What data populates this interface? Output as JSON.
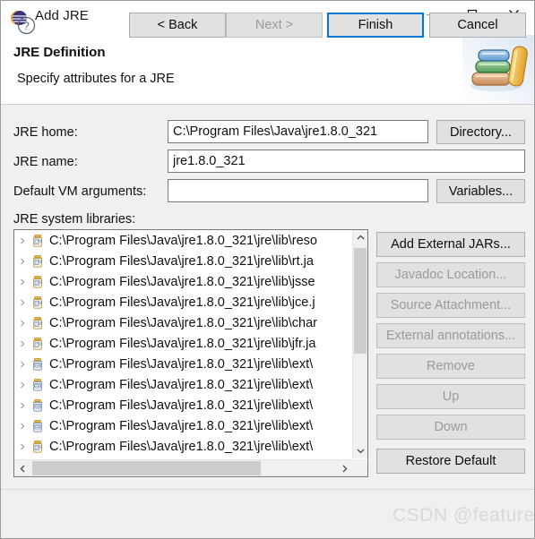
{
  "window": {
    "title": "Add JRE",
    "icon": "eclipse-icon",
    "controls": {
      "minimize": "minimize-icon",
      "maximize": "maximize-icon",
      "close": "close-icon"
    }
  },
  "header": {
    "title": "JRE Definition",
    "description": "Specify attributes for a JRE",
    "image": "books-stack-image"
  },
  "form": {
    "jre_home_label": "JRE home:",
    "jre_home_value": "C:\\Program Files\\Java\\jre1.8.0_321",
    "jre_home_placeholder": "",
    "directory_button": "Directory...",
    "jre_name_label": "JRE name:",
    "jre_name_value": "jre1.8.0_321",
    "jre_name_placeholder": "",
    "vm_args_label": "Default VM arguments:",
    "vm_args_value": "",
    "vm_args_placeholder": "",
    "variables_button": "Variables...",
    "system_libraries_label": "JRE system libraries:"
  },
  "tree": {
    "rows": [
      {
        "label": "C:\\Program Files\\Java\\jre1.8.0_321\\jre\\lib\\reso",
        "icon": "jar-doc-icon"
      },
      {
        "label": "C:\\Program Files\\Java\\jre1.8.0_321\\jre\\lib\\rt.ja",
        "icon": "jar-doc-icon"
      },
      {
        "label": "C:\\Program Files\\Java\\jre1.8.0_321\\jre\\lib\\jsse",
        "icon": "jar-doc-icon"
      },
      {
        "label": "C:\\Program Files\\Java\\jre1.8.0_321\\jre\\lib\\jce.j",
        "icon": "jar-doc-icon"
      },
      {
        "label": "C:\\Program Files\\Java\\jre1.8.0_321\\jre\\lib\\char",
        "icon": "jar-doc-icon"
      },
      {
        "label": "C:\\Program Files\\Java\\jre1.8.0_321\\jre\\lib\\jfr.ja",
        "icon": "jar-doc-icon"
      },
      {
        "label": "C:\\Program Files\\Java\\jre1.8.0_321\\jre\\lib\\ext\\",
        "icon": "jar-icon"
      },
      {
        "label": "C:\\Program Files\\Java\\jre1.8.0_321\\jre\\lib\\ext\\",
        "icon": "jar-icon"
      },
      {
        "label": "C:\\Program Files\\Java\\jre1.8.0_321\\jre\\lib\\ext\\",
        "icon": "jar-icon"
      },
      {
        "label": "C:\\Program Files\\Java\\jre1.8.0_321\\jre\\lib\\ext\\",
        "icon": "jar-icon"
      },
      {
        "label": "C:\\Program Files\\Java\\jre1.8.0_321\\jre\\lib\\ext\\",
        "icon": "jar-doc-icon"
      }
    ]
  },
  "side_buttons": [
    {
      "label": "Add External JARs...",
      "enabled": true
    },
    {
      "label": "Javadoc Location...",
      "enabled": false
    },
    {
      "label": "Source Attachment...",
      "enabled": false
    },
    {
      "label": "External annotations...",
      "enabled": false
    },
    {
      "label": "Remove",
      "enabled": false
    },
    {
      "label": "Up",
      "enabled": false
    },
    {
      "label": "Down",
      "enabled": false
    },
    {
      "label": "Restore Default",
      "enabled": true
    }
  ],
  "footer": {
    "help_icon": "help-icon",
    "back_button": "< Back",
    "next_button": "Next >",
    "finish_button": "Finish",
    "cancel_button": "Cancel",
    "watermark": "CSDN @featureA"
  },
  "colors": {
    "accent": "#0078d7",
    "dialog_bg": "#f0f0f0",
    "button_bg": "#e1e1e1",
    "disabled_text": "#9a9a9a",
    "watermark": "#d8d8d8"
  }
}
